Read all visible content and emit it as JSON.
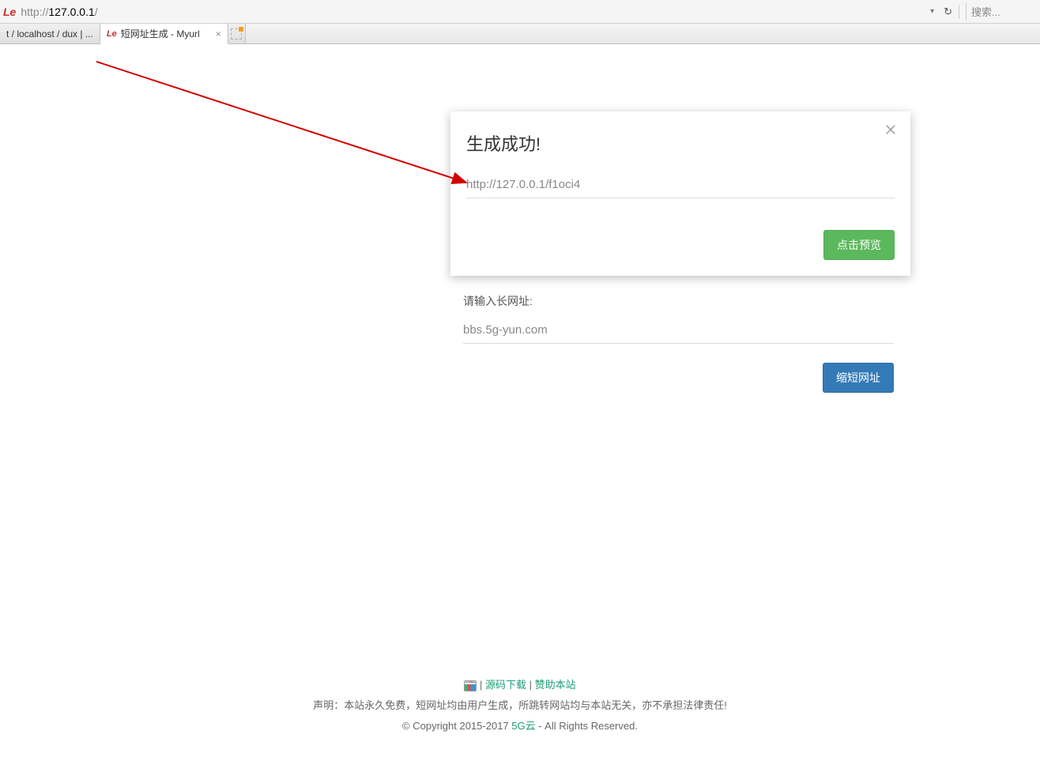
{
  "addressBar": {
    "urlPrefix": "http://",
    "urlHost": "127.0.0.1",
    "urlSuffix": "/",
    "searchPlaceholder": "搜索..."
  },
  "tabs": {
    "inactive": "t / localhost / dux | ...",
    "active": "短网址生成 - Myurl"
  },
  "modal": {
    "title": "生成成功!",
    "resultUrl": "http://127.0.0.1/f1oci4",
    "previewBtn": "点击预览"
  },
  "form": {
    "label": "请输入长网址:",
    "value": "bbs.5g-yun.com",
    "submitBtn": "缩短网址"
  },
  "footer": {
    "link1": "源码下载",
    "link2": "赞助本站",
    "disclaimer": "声明：本站永久免费，短网址均由用户生成，所跳转网站均与本站无关，亦不承担法律责任!",
    "copyrightPrefix": "© Copyright 2015-2017 ",
    "copyrightLink": "5G云",
    "copyrightSuffix": " - All Rights Reserved."
  }
}
